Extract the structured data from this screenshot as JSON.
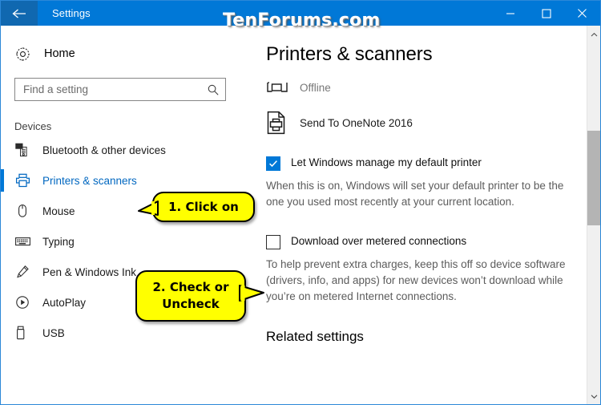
{
  "window": {
    "title": "Settings",
    "back_icon": "back-arrow-icon",
    "controls": [
      {
        "name": "minimize-button",
        "glyph": "minimize-icon"
      },
      {
        "name": "maximize-button",
        "glyph": "maximize-icon"
      },
      {
        "name": "close-button",
        "glyph": "close-icon"
      }
    ],
    "accent_color": "#0078d7",
    "titlebar_color": "#0078d7"
  },
  "watermark": {
    "text": "TenForums.com"
  },
  "sidebar": {
    "home": {
      "label": "Home",
      "icon": "gear-icon"
    },
    "search": {
      "placeholder": "Find a setting",
      "value": "",
      "icon": "search-icon"
    },
    "group_label": "Devices",
    "items": [
      {
        "label": "Bluetooth & other devices",
        "icon": "bluetooth-devices-icon",
        "selected": false
      },
      {
        "label": "Printers & scanners",
        "icon": "printer-icon",
        "selected": true
      },
      {
        "label": "Mouse",
        "icon": "mouse-icon",
        "selected": false
      },
      {
        "label": "Typing",
        "icon": "keyboard-icon",
        "selected": false
      },
      {
        "label": "Pen & Windows Ink",
        "icon": "pen-icon",
        "selected": false
      },
      {
        "label": "AutoPlay",
        "icon": "autoplay-icon",
        "selected": false
      },
      {
        "label": "USB",
        "icon": "usb-icon",
        "selected": false
      }
    ],
    "selected_color": "#0067c0"
  },
  "main": {
    "page_title": "Printers & scanners",
    "printers": [
      {
        "name": "Offline",
        "icon": "fax-device-icon",
        "dim": true
      },
      {
        "name": "Send To OneNote 2016",
        "icon": "document-printer-icon",
        "dim": false
      }
    ],
    "settings": [
      {
        "label": "Let Windows manage my default printer",
        "checked": true,
        "description": "When this is on, Windows will set your default printer to be the one you used most recently at your current location."
      },
      {
        "label": "Download over metered connections",
        "checked": false,
        "description": "To help prevent extra charges, keep this off so device software (drivers, info, and apps) for new devices won’t download while you’re on metered Internet connections."
      }
    ],
    "related_settings_heading": "Related settings"
  },
  "scrollbar": {
    "up_icon": "chevron-up-icon",
    "down_icon": "chevron-down-icon",
    "thumb": "scrollbar-thumb"
  },
  "callouts": [
    {
      "text": "1. Click on",
      "color": "#ffff00"
    },
    {
      "text": "2. Check or\nUncheck",
      "color": "#ffff00"
    }
  ]
}
